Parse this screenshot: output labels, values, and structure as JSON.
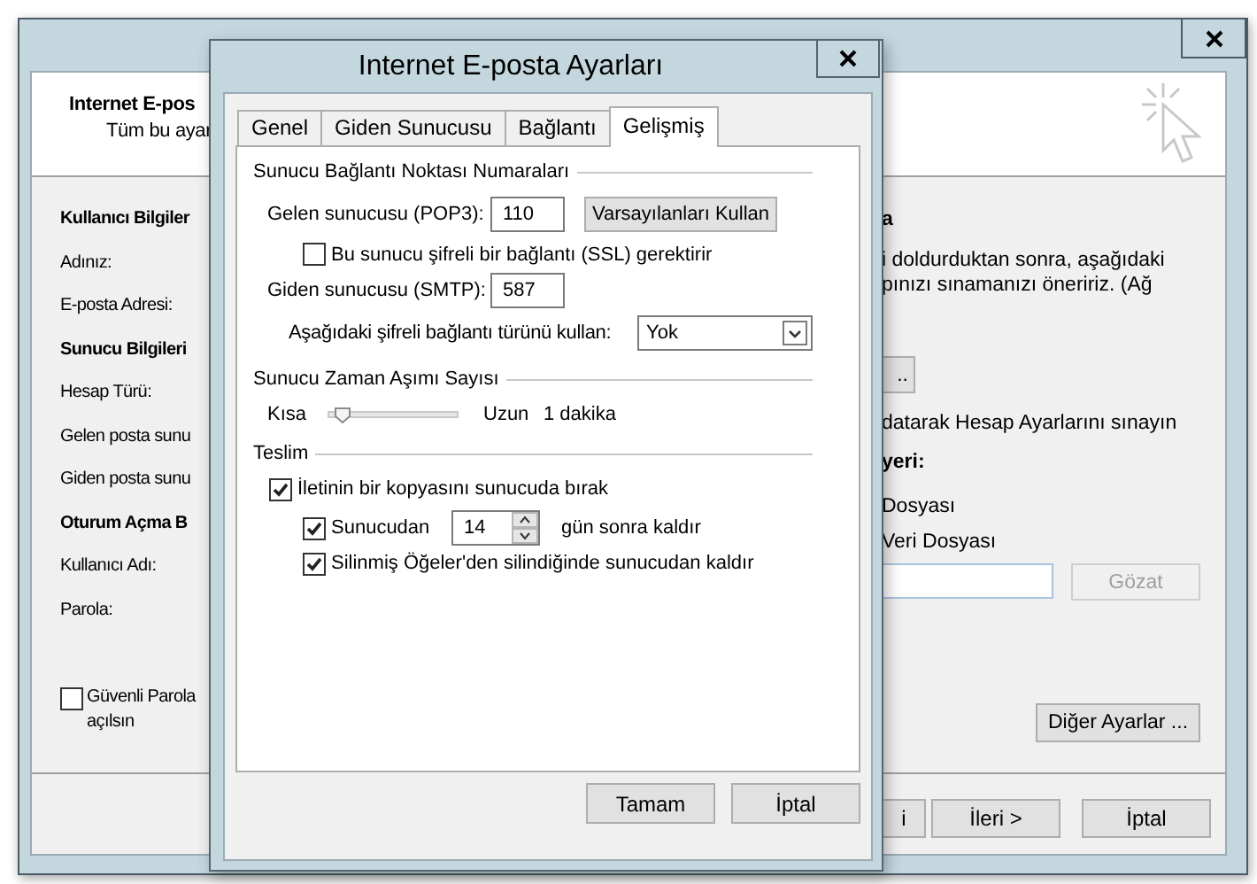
{
  "background_window": {
    "header": {
      "title": "Internet E-pos",
      "subtitle": "Tüm bu ayar"
    },
    "left_items": [
      {
        "kind": "heading",
        "text": "Kullanıcı Bilgiler"
      },
      {
        "kind": "label",
        "text": "Adınız:"
      },
      {
        "kind": "label",
        "text": "E-posta Adresi:"
      },
      {
        "kind": "heading",
        "text": "Sunucu Bilgileri"
      },
      {
        "kind": "label",
        "text": "Hesap Türü:"
      },
      {
        "kind": "label",
        "text": "Gelen posta sunu"
      },
      {
        "kind": "label",
        "text": "Giden posta sunu"
      },
      {
        "kind": "heading",
        "text": "Oturum Açma B"
      },
      {
        "kind": "label",
        "text": "Kullanıcı Adı:"
      },
      {
        "kind": "label",
        "text": "Parola:"
      }
    ],
    "secure_password_checkbox": {
      "label_lines": [
        "Güvenli Parola",
        "açılsın"
      ],
      "checked": false
    },
    "right_heading": "a",
    "right_paragraph_lines": [
      "i doldurduktan sonra, aşağıdaki",
      "pınızı sınamanızı öneririz. (Ağ"
    ],
    "test_button": "..",
    "test_text": "datarak Hesap Ayarlarını sınayın",
    "delivery_heading": "yeri:",
    "file_options": [
      "Dosyası",
      "Veri Dosyası"
    ],
    "browse_button": {
      "label": "Gözat",
      "disabled": true
    },
    "more_settings_button": "Diğer Ayarlar ...",
    "footer_buttons": [
      "i",
      "İleri >",
      "İptal"
    ]
  },
  "dialog": {
    "title": "Internet E-posta Ayarları",
    "tabs": [
      {
        "label": "Genel",
        "selected": false
      },
      {
        "label": "Giden Sunucusu",
        "selected": false
      },
      {
        "label": "Bağlantı",
        "selected": false
      },
      {
        "label": "Gelişmiş",
        "selected": true
      }
    ],
    "port_group": {
      "title": "Sunucu Bağlantı Noktası Numaraları",
      "incoming_label": "Gelen sunucusu (POP3):",
      "incoming_value": "110",
      "defaults_button": "Varsayılanları Kullan",
      "ssl_checkbox": {
        "label": "Bu sunucu şifreli bir bağlantı (SSL) gerektirir",
        "checked": false
      },
      "outgoing_label": "Giden sunucusu (SMTP):",
      "outgoing_value": "587",
      "encryption_label": "Aşağıdaki şifreli bağlantı türünü kullan:",
      "encryption_value": "Yok"
    },
    "timeout_group": {
      "title": "Sunucu Zaman Aşımı Sayısı",
      "short_label": "Kısa",
      "level": 0.1,
      "long_label": "Uzun",
      "reading": "1 dakika"
    },
    "delivery_group": {
      "title": "Teslim",
      "leave_copy": {
        "label": "İletinin bir kopyasını sunucuda bırak",
        "checked": true
      },
      "remove_after": {
        "label": "Sunucudan",
        "checked": true,
        "days": "14",
        "suffix": "gün sonra kaldır"
      },
      "remove_deleted": {
        "label": "Silinmiş Öğeler'den silindiğinde sunucudan kaldır",
        "checked": true
      }
    },
    "buttons": [
      "Tamam",
      "İptal"
    ]
  }
}
